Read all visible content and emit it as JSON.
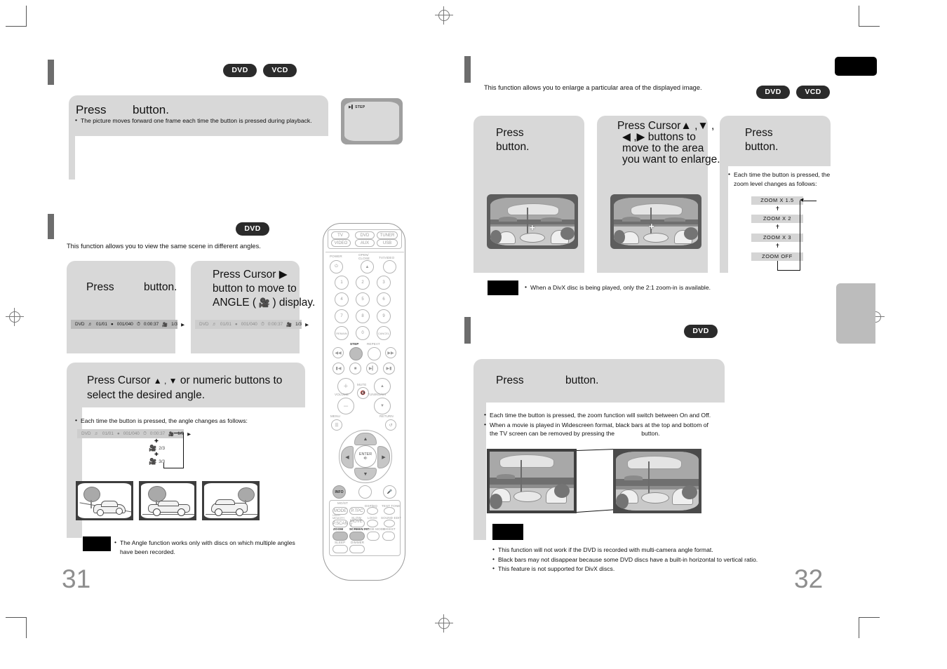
{
  "document": {
    "left_page_number": "31",
    "right_page_number": "32"
  },
  "left_page": {
    "step_section": {
      "disc_badges": [
        "DVD",
        "VCD"
      ],
      "step_box": {
        "press_prefix": "Press",
        "press_suffix": "button.",
        "bullets": [
          "The picture moves forward one frame each time the button is pressed during playback."
        ]
      },
      "tv_osd_label": "STEP"
    },
    "angle_section": {
      "disc_badges": [
        "DVD"
      ],
      "intro": "This function allows you to view the same scene in different angles.",
      "step1": {
        "press_prefix": "Press",
        "press_suffix": "button.",
        "osd": {
          "disc": "DVD",
          "title": "01/01",
          "chapter": "001/040",
          "time": "0:00:37",
          "angle": "1/3"
        }
      },
      "step2": {
        "line1": "Press Cursor ▶",
        "line2": "button to move to",
        "line3_prefix": "ANGLE (",
        "line3_suffix": ") display.",
        "osd": {
          "disc": "DVD",
          "title": "01/01",
          "chapter": "001/040",
          "time": "0:00:37",
          "angle": "1/3"
        }
      },
      "step3": {
        "line1_prefix": "Press Cursor",
        "line1_arrows": "▲ , ▼",
        "line1_suffix": "or numeric buttons to",
        "line2": "select the desired angle.",
        "bullet": "Each time the button is pressed, the angle changes as follows:",
        "osd": {
          "disc": "DVD",
          "title": "01/01",
          "chapter": "001/040",
          "time": "0:00:37",
          "angle": "1/3"
        },
        "angle_sequence": [
          "1/3",
          "2/3",
          "3/3"
        ]
      },
      "note": {
        "label": "",
        "bullets": [
          "The Angle function works only with discs on which multiple angles have been recorded."
        ]
      }
    }
  },
  "right_page": {
    "zoom_section": {
      "title_redacted": true,
      "intro": "This function allows you to enlarge a particular area of the displayed image.",
      "disc_badges": [
        "DVD",
        "VCD"
      ],
      "step1": {
        "line1": "Press",
        "line2": "button."
      },
      "step2": {
        "line1": "Press Cursor▲ ,▼ ,",
        "line2": "◀ ,▶ buttons to",
        "line3": "move to the area",
        "line4": "you want to enlarge."
      },
      "step3": {
        "line1": "Press",
        "line2": "button.",
        "bullet": "Each time the button is pressed, the zoom level changes as follows:",
        "zoom_levels": [
          "ZOOM X 1.5",
          "ZOOM X 2",
          "ZOOM X 3",
          "ZOOM  OFF"
        ]
      },
      "note": {
        "bullets": [
          "When a DivX disc is being played, only the 2:1 zoom-in is available."
        ]
      }
    },
    "screenfit_section": {
      "title_redacted": true,
      "disc_badges": [
        "DVD"
      ],
      "box": {
        "press_prefix": "Press",
        "press_suffix": "button."
      },
      "bullets": [
        "Each time the button is pressed, the zoom function will switch between On and Off.",
        "When a movie is played in Widescreen format, black bars at the top and bottom of the TV screen can be removed by pressing the                button."
      ],
      "note": {
        "bullets": [
          "This function will not work if the DVD is recorded with multi-camera angle format.",
          "Black bars may not disappear because some DVD discs have a built-in horizontal to vertical ratio.",
          "This feature is not supported for DivX discs."
        ]
      }
    }
  },
  "remote": {
    "source_keys": [
      "TV",
      "DVD",
      "TUNER",
      "VIDEO",
      "AUX",
      "USB"
    ],
    "top_labels": [
      "POWER",
      "OPEN/\nCLOSE",
      "TV/VIDEO"
    ],
    "numeric_keys": [
      "1",
      "2",
      "3",
      "4",
      "5",
      "6",
      "7",
      "8",
      "9",
      "REMAIN",
      "0",
      "CANCEL"
    ],
    "transport_labels": [
      "STEP",
      "REPEAT"
    ],
    "volume_label": "VOLUME",
    "mute_label": "MUTE",
    "tuning_label": "TUNING/CH",
    "menu_label": "MENU",
    "return_label": "RETURN",
    "enter_label": "ENTER",
    "info_label": "INFO",
    "bottom_keys": [
      "MO/ST",
      "MODE",
      "P.TPC",
      "DSP/EQ",
      "TEST TONE",
      "USER MEMORY",
      "SLOW",
      "LOGO",
      "SOUND EDIT",
      "P.SCAN",
      "MOVE T",
      "ZOOM",
      "SCREEN FIT",
      "SLIDE MODE",
      "DIGEST",
      "SLEEP",
      "DIMMER"
    ],
    "highlighted_keys": [
      "STEP",
      "ZOOM",
      "SCREEN FIT"
    ]
  },
  "colors": {
    "grey_box": "#d8d8d8",
    "section_bar": "#6d6d6d",
    "pill_bg": "#2b2b2b",
    "page_number": "#8e8e8e",
    "osd_bg": "#b9b9b9"
  }
}
